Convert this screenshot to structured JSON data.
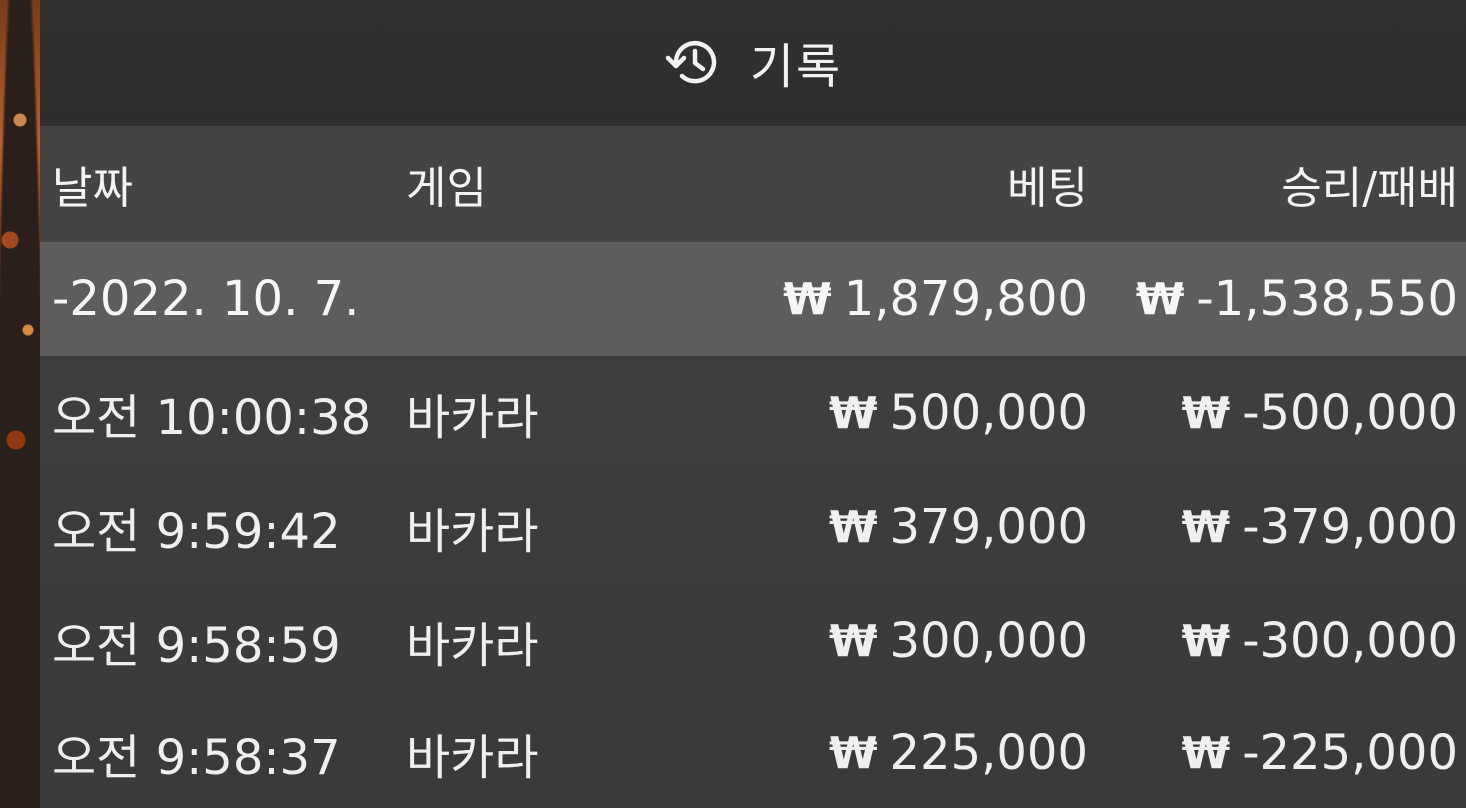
{
  "header": {
    "title": "기록",
    "icon": "history-icon"
  },
  "columns": {
    "date": "날짜",
    "game": "게임",
    "bet": "베팅",
    "result": "승리/패배"
  },
  "currency_symbol": "₩",
  "summary": {
    "date": "-2022. 10. 7.",
    "bet": "1,879,800",
    "result": "-1,538,550"
  },
  "rows": [
    {
      "time": "오전 10:00:38",
      "game": "바카라",
      "bet": "500,000",
      "result": "-500,000"
    },
    {
      "time": "오전 9:59:42",
      "game": "바카라",
      "bet": "379,000",
      "result": "-379,000"
    },
    {
      "time": "오전 9:58:59",
      "game": "바카라",
      "bet": "300,000",
      "result": "-300,000"
    },
    {
      "time": "오전 9:58:37",
      "game": "바카라",
      "bet": "225,000",
      "result": "-225,000"
    }
  ]
}
